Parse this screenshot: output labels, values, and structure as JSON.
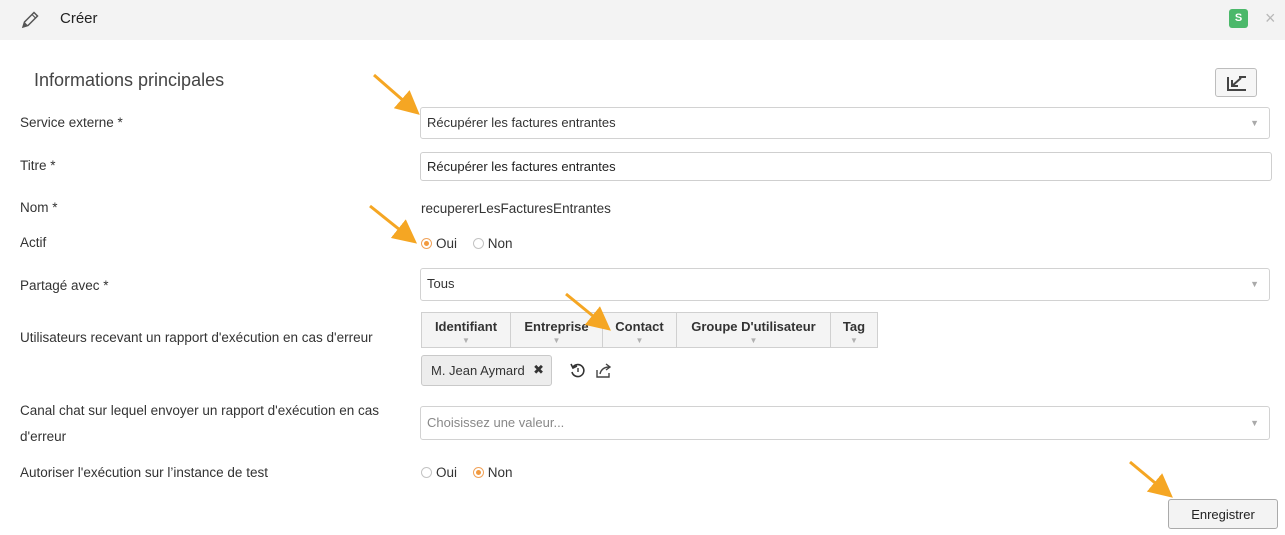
{
  "header": {
    "title": "Créer",
    "badge": "S",
    "close_symbol": "×",
    "icon": "pencil-icon"
  },
  "section_title": "Informations principales",
  "form": {
    "service_externe": {
      "label": "Service externe *",
      "value": "Récupérer les factures entrantes"
    },
    "titre": {
      "label": "Titre *",
      "value": "Récupérer les factures entrantes"
    },
    "nom": {
      "label": "Nom *",
      "value": "recupererLesFacturesEntrantes"
    },
    "actif": {
      "label": "Actif",
      "options": [
        "Oui",
        "Non"
      ],
      "selected": "Oui"
    },
    "partage": {
      "label": "Partagé avec *",
      "value": "Tous"
    },
    "utilisateurs": {
      "label": "Utilisateurs recevant un rapport d'exécution en cas d'erreur",
      "tabs": [
        "Identifiant",
        "Entreprise",
        "Contact",
        "Groupe D'utilisateur",
        "Tag"
      ],
      "selected_tag": "M. Jean Aymard",
      "remove_symbol": "✖"
    },
    "canal_chat": {
      "label": "Canal chat sur lequel envoyer un rapport d'exécution en cas d'erreur",
      "placeholder": "Choisissez une valeur..."
    },
    "instance_test": {
      "label": "Autoriser l'exécution sur l’instance de test",
      "options": [
        "Oui",
        "Non"
      ],
      "selected": "Non"
    }
  },
  "save_label": "Enregistrer",
  "colors": {
    "accent": "#f29a3f",
    "badge": "#4bb86a",
    "annotation_arrow": "#f5a623"
  }
}
